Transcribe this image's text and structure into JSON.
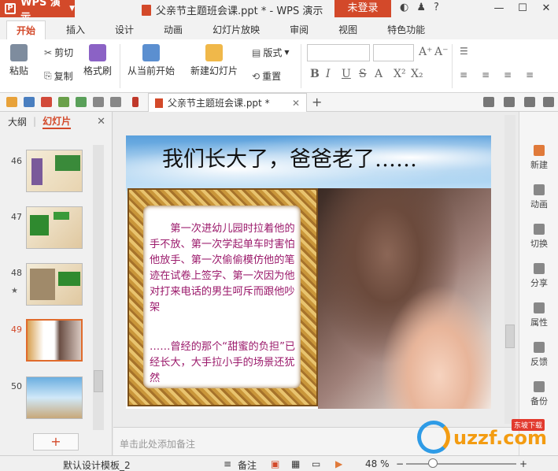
{
  "app": {
    "menu_label": "WPS 演示",
    "logo_glyph": "P"
  },
  "window": {
    "title": "父亲节主题班会课.ppt * - WPS 演示",
    "login_label": "未登录"
  },
  "ribbon_tabs": [
    "开始",
    "插入",
    "设计",
    "动画",
    "幻灯片放映",
    "审阅",
    "视图",
    "特色功能"
  ],
  "ribbon": {
    "paste": "粘贴",
    "cut": "剪切",
    "copy": "复制",
    "format_painter": "格式刷",
    "from_current": "从当前开始",
    "new_slide": "新建幻灯片",
    "layout": "版式",
    "reset": "重置",
    "font_size_buttons": [
      "A⁺",
      "A⁻",
      "◇"
    ],
    "format_buttons": [
      "B",
      "I",
      "U",
      "S",
      "A",
      "X²",
      "X₂"
    ]
  },
  "doc_tab": {
    "label": "父亲节主题班会课.ppt *"
  },
  "left_panel": {
    "tab_outline": "大纲",
    "tab_slides": "幻灯片",
    "thumbnails": [
      {
        "num": "46",
        "current": false
      },
      {
        "num": "47",
        "current": false
      },
      {
        "num": "48",
        "current": false,
        "star": "★"
      },
      {
        "num": "49",
        "current": true
      },
      {
        "num": "50",
        "current": false
      }
    ],
    "add_button": "+"
  },
  "slide": {
    "title": "我们长大了，爸爸老了……",
    "body_para1": "第一次进幼儿园时拉着他的手不放、第一次学起单车时害怕他放手、第一次偷偷模仿他的笔迹在试卷上签字、第一次因为他对打来电话的男生呵斥而跟他吵架",
    "body_para2": "……曾经的那个“甜蜜的负担”已经长大，大手拉小手的场景还犹然"
  },
  "notes_placeholder": "单击此处添加备注",
  "right_sidebar": [
    {
      "label": "新建",
      "icon": "new-icon"
    },
    {
      "label": "动画",
      "icon": "animation-icon"
    },
    {
      "label": "切换",
      "icon": "transition-icon"
    },
    {
      "label": "分享",
      "icon": "share-icon"
    },
    {
      "label": "属性",
      "icon": "properties-icon"
    },
    {
      "label": "反馈",
      "icon": "feedback-icon"
    },
    {
      "label": "备份",
      "icon": "backup-icon"
    }
  ],
  "status": {
    "template": "默认设计模板_2",
    "notes_toggle": "备注",
    "zoom": "48 %",
    "zoom_minus": "−",
    "zoom_plus": "+"
  },
  "watermark": {
    "text": "uzzf.com",
    "badge": "东坡下载"
  },
  "colors": {
    "accent": "#d3492a",
    "slide_text": "#9b1a6b"
  }
}
